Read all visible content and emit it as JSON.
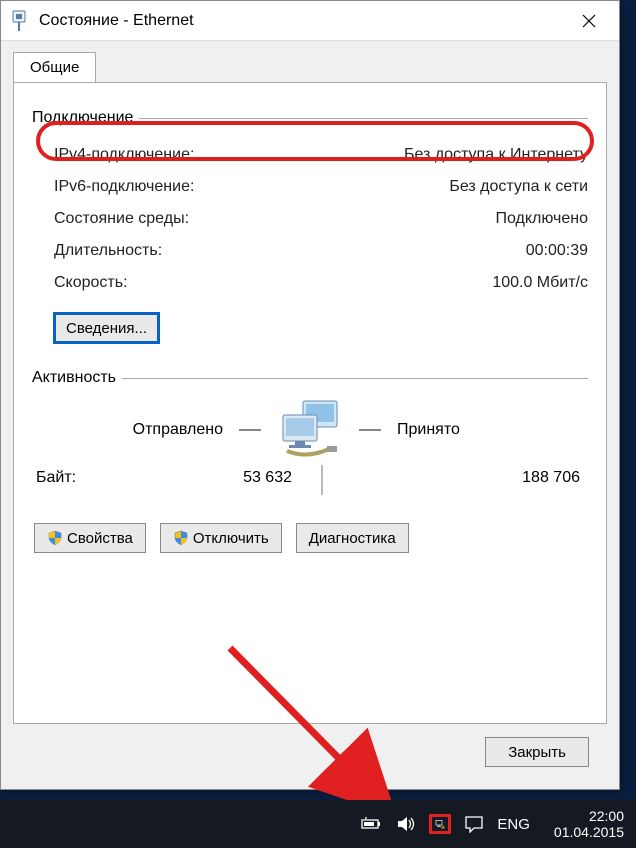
{
  "window": {
    "title": "Состояние - Ethernet"
  },
  "tabs": {
    "general": "Общие"
  },
  "connection": {
    "header": "Подключение",
    "ipv4_label": "IPv4-подключение:",
    "ipv4_value": "Без доступа к Интернету",
    "ipv6_label": "IPv6-подключение:",
    "ipv6_value": "Без доступа к сети",
    "media_label": "Состояние среды:",
    "media_value": "Подключено",
    "duration_label": "Длительность:",
    "duration_value": "00:00:39",
    "speed_label": "Скорость:",
    "speed_value": "100.0 Мбит/с",
    "details_btn": "Сведения..."
  },
  "activity": {
    "header": "Активность",
    "sent_label": "Отправлено",
    "recv_label": "Принято",
    "bytes_label": "Байт:",
    "sent_value": "53 632",
    "recv_value": "188 706"
  },
  "buttons": {
    "properties": "Свойства",
    "disable": "Отключить",
    "diagnose": "Диагностика",
    "close": "Закрыть"
  },
  "taskbar": {
    "lang": "ENG",
    "time": "22:00",
    "date": "01.04.2015"
  }
}
